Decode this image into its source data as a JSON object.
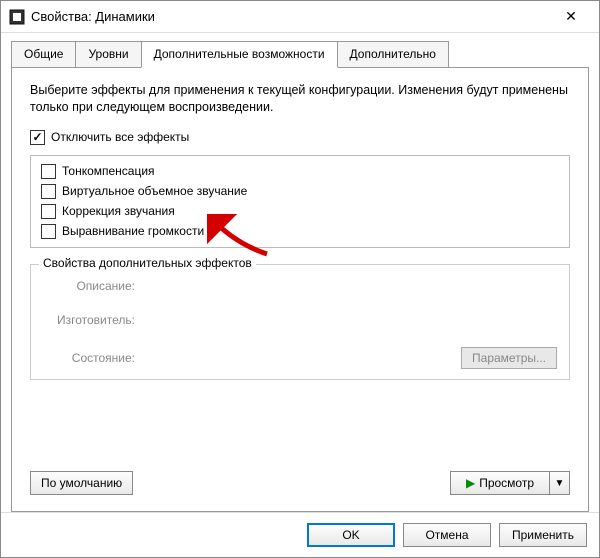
{
  "titlebar": {
    "title": "Свойства: Динамики",
    "close_glyph": "✕"
  },
  "tabs": [
    {
      "label": "Общие"
    },
    {
      "label": "Уровни"
    },
    {
      "label": "Дополнительные возможности"
    },
    {
      "label": "Дополнительно"
    }
  ],
  "active_tab": 2,
  "panel": {
    "instructions": "Выберите эффекты для применения к текущей конфигурации. Изменения будут применены только при следующем воспроизведении.",
    "disable_all": {
      "label": "Отключить все эффекты",
      "checked": true
    },
    "effects": [
      {
        "label": "Тонкомпенсация",
        "checked": false
      },
      {
        "label": "Виртуальное объемное звучание",
        "checked": false
      },
      {
        "label": "Коррекция звучания",
        "checked": false
      },
      {
        "label": "Выравнивание громкости",
        "checked": false
      }
    ],
    "props_group": {
      "title": "Свойства дополнительных эффектов",
      "desc_label": "Описание:",
      "vendor_label": "Изготовитель:",
      "status_label": "Состояние:",
      "params_button": "Параметры..."
    },
    "defaults_button": "По умолчанию",
    "preview_button": "Просмотр"
  },
  "dialog": {
    "ok": "OK",
    "cancel": "Отмена",
    "apply": "Применить"
  }
}
